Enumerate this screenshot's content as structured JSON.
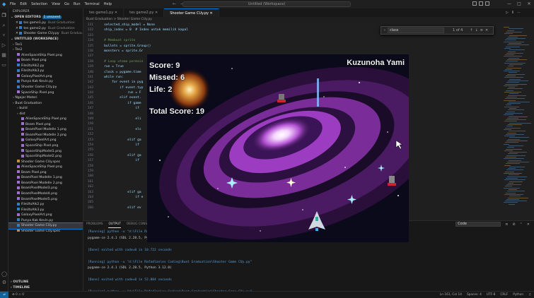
{
  "titlebar": {
    "menu": [
      "File",
      "Edit",
      "Selection",
      "View",
      "Go",
      "Run",
      "Terminal",
      "Help"
    ],
    "search": "Untitled (Workspace)"
  },
  "sidebar": {
    "title": "EXPLORER",
    "open_editors": "OPEN EDITORS",
    "unsaved_badge": "1 unsaved",
    "open_files": [
      {
        "name": "tes game1.py",
        "path": "Buat Graduation"
      },
      {
        "name": "tes game2.py",
        "path": "Buat Graduation"
      },
      {
        "name": "Shooter Game CUy.py",
        "path": "Buat Gradua..."
      }
    ],
    "workspace": "UNTITLED (WORKSPACE)",
    "tree": [
      {
        "name": "Tes1",
        "type": "folder",
        "indent": 1
      },
      {
        "name": "Tes2",
        "type": "folder",
        "indent": 1
      },
      {
        "name": "AlienSpaceShip Pixel.png",
        "type": "png",
        "indent": 2
      },
      {
        "name": "Beam Pixel.png",
        "type": "png",
        "indent": 2
      },
      {
        "name": "FileUtsAlk2.py",
        "type": "py",
        "indent": 2
      },
      {
        "name": "FileUtsAlk3.py",
        "type": "py",
        "indent": 2
      },
      {
        "name": "GalaxyPixelArt.png",
        "type": "png",
        "indent": 2
      },
      {
        "name": "Punya Kak Kevin.py",
        "type": "py",
        "indent": 2
      },
      {
        "name": "Shooter Game CUy.py",
        "type": "py",
        "indent": 2
      },
      {
        "name": "SpaceShip Pixel.png",
        "type": "png",
        "indent": 2
      },
      {
        "name": "Ngajar Materi",
        "type": "folder",
        "indent": 1
      },
      {
        "name": "Buat Graduation",
        "type": "folder",
        "indent": 1
      },
      {
        "name": "build",
        "type": "folder",
        "indent": 2
      },
      {
        "name": "dist",
        "type": "folder",
        "indent": 2
      },
      {
        "name": "AlienSpaceShip Pixel.png",
        "type": "png",
        "indent": 3
      },
      {
        "name": "Beam Pixel.png",
        "type": "png",
        "indent": 3
      },
      {
        "name": "BeamPixel Modelle 1.png",
        "type": "png",
        "indent": 3
      },
      {
        "name": "BeamPixel Modelle 2.png",
        "type": "png",
        "indent": 3
      },
      {
        "name": "GalaxyPixelArt.png",
        "type": "png",
        "indent": 3
      },
      {
        "name": "SpaceShip Pixel.png",
        "type": "png",
        "indent": 3
      },
      {
        "name": "SpaceShipModel1.png",
        "type": "png",
        "indent": 3
      },
      {
        "name": "SpaceShipModel2.png",
        "type": "png",
        "indent": 3
      },
      {
        "name": "Shooter Game CUy.spec",
        "type": "spec",
        "indent": 2
      },
      {
        "name": "AlienSpaceShip Pixel.png",
        "type": "png",
        "indent": 2
      },
      {
        "name": "Beam Pixel.png",
        "type": "png",
        "indent": 2
      },
      {
        "name": "BeamPixel Modelle 1.png",
        "type": "png",
        "indent": 2
      },
      {
        "name": "BeamPixel Modelle 2.png",
        "type": "png",
        "indent": 2
      },
      {
        "name": "BeamPixelModel3.png",
        "type": "png",
        "indent": 2
      },
      {
        "name": "BeamPixelModel4.png",
        "type": "png",
        "indent": 2
      },
      {
        "name": "BeamPixelModel5.png",
        "type": "png",
        "indent": 2
      },
      {
        "name": "FileUtsAlk2.py",
        "type": "py",
        "indent": 2
      },
      {
        "name": "FileUtsAlk3.py",
        "type": "py",
        "indent": 2
      },
      {
        "name": "GalaxyPixelArt.png",
        "type": "png",
        "indent": 2
      },
      {
        "name": "Punya Kak Kevin.py",
        "type": "py",
        "indent": 2
      },
      {
        "name": "Shooter Game CUy.py",
        "type": "py",
        "indent": 2,
        "selected": true
      },
      {
        "name": "Shooter Game CUy.spec",
        "type": "spec",
        "indent": 2
      }
    ],
    "outline": "OUTLINE",
    "timeline": "TIMELINE"
  },
  "tabs": [
    {
      "label": "tes game1.py",
      "active": false
    },
    {
      "label": "tes game2.py",
      "active": false
    },
    {
      "label": "Shooter Game CUy.py",
      "active": true
    }
  ],
  "breadcrumb": "Buat Graduation > Shooter Game CUy.py",
  "code_lines": [
    {
      "n": "131",
      "t": "    selected_ship_model = None"
    },
    {
      "n": "132",
      "t": "    ship_index = 0  # Index untuk memilih kapal"
    },
    {
      "n": "133",
      "t": ""
    },
    {
      "n": "134",
      "t": "    # Membuat sprite"
    },
    {
      "n": "135",
      "t": "    bullets = sprite.Group()"
    },
    {
      "n": "136",
      "t": "    monsters = sprite.Gr"
    },
    {
      "n": "137",
      "t": ""
    },
    {
      "n": "138",
      "t": "    # Loop utama permain"
    },
    {
      "n": "139",
      "t": "    run = True"
    },
    {
      "n": "140",
      "t": "    clock = pygame.time"
    },
    {
      "n": "141",
      "t": "    while run:"
    },
    {
      "n": "142",
      "t": "        for event in pyg"
    },
    {
      "n": "143",
      "t": "            if event.typ"
    },
    {
      "n": "144",
      "t": "                run = F"
    },
    {
      "n": "145",
      "t": "            elif event."
    },
    {
      "n": "146",
      "t": "                if game"
    },
    {
      "n": "147",
      "t": "                    if"
    },
    {
      "n": "148",
      "t": ""
    },
    {
      "n": "149",
      "t": "                    eli"
    },
    {
      "n": "150",
      "t": ""
    },
    {
      "n": "151",
      "t": "                    els"
    },
    {
      "n": "152",
      "t": ""
    },
    {
      "n": "153",
      "t": "                elif ga"
    },
    {
      "n": "154",
      "t": "                    if"
    },
    {
      "n": "155",
      "t": ""
    },
    {
      "n": "156",
      "t": "                elif ga"
    },
    {
      "n": "157",
      "t": "                    if"
    },
    {
      "n": "158",
      "t": ""
    },
    {
      "n": "159",
      "t": ""
    },
    {
      "n": "160",
      "t": ""
    },
    {
      "n": "161",
      "t": ""
    },
    {
      "n": "162",
      "t": ""
    },
    {
      "n": "163",
      "t": "                elif ga"
    },
    {
      "n": "164",
      "t": "                    if e"
    },
    {
      "n": "165",
      "t": ""
    },
    {
      "n": "166",
      "t": "                elif ev"
    }
  ],
  "find": {
    "value": "class",
    "count": "1 of 4"
  },
  "panel": {
    "tabs": [
      "PROBLEMS",
      "OUTPUT",
      "DEBUG CONSOLE",
      "TERMINAL",
      "PORTS"
    ],
    "active_tab": "OUTPUT",
    "select": "Code",
    "lines": [
      {
        "cls": "run",
        "t": "[Running] python -u \"d:\\File Rafadlan\\es Coding\\Buat Graduation\\Shooter Game CUy.py\""
      },
      {
        "cls": "",
        "t": "pygame-ce 2.4.1 (SDL 2.28.5, Python 3.12.0)"
      },
      {
        "cls": "",
        "t": ""
      },
      {
        "cls": "run",
        "t": "[Done] exited with code=0 in 10.722 seconds"
      },
      {
        "cls": "",
        "t": ""
      },
      {
        "cls": "run",
        "t": "[Running] python -u \"d:\\File Rafadlan\\es Coding\\Buat Graduation\\Shooter Game CUy.py\""
      },
      {
        "cls": "",
        "t": "pygame-ce 2.4.1 (SDL 2.28.5, Python 3.12.0)"
      },
      {
        "cls": "",
        "t": ""
      },
      {
        "cls": "run",
        "t": "[Done] exited with code=0 in 52.804 seconds"
      },
      {
        "cls": "",
        "t": ""
      },
      {
        "cls": "run",
        "t": "[Running] python -u \"d:\\File Rafadlan\\es Coding\\Buat Graduation\\Shooter Game CUy.py\""
      }
    ]
  },
  "statusbar": {
    "errors": "0",
    "warnings": "0",
    "position": "Ln 161, Col 14",
    "spaces": "Spaces: 4",
    "encoding": "UTF-8",
    "eol": "CRLF",
    "language": "Python"
  },
  "game": {
    "player_name": "Kuzunoha Yami",
    "score": "Score: 9",
    "missed": "Missed: 6",
    "life": "Life: 2",
    "total_score": "Total Score: 19"
  },
  "colors": {
    "accent": "#0078d4",
    "galaxy": "#a040c0"
  }
}
